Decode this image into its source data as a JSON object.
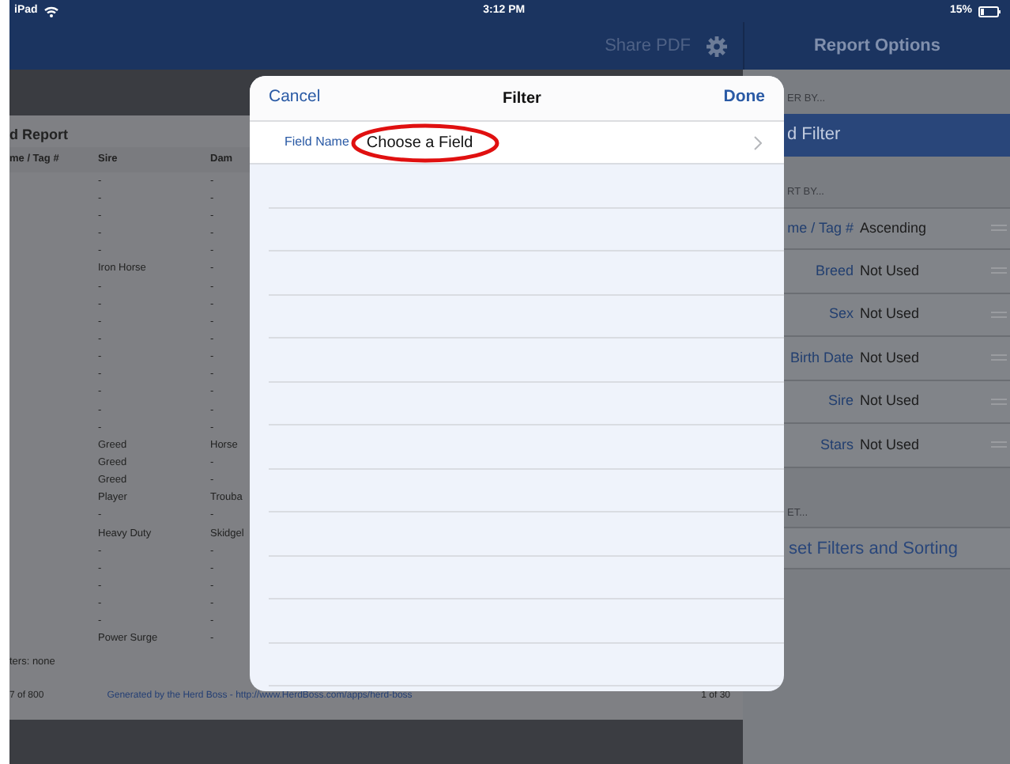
{
  "status_bar": {
    "device": "iPad",
    "time": "3:12 PM",
    "battery": "15%"
  },
  "toolbar": {
    "share": "Share PDF"
  },
  "report": {
    "title": "d Report",
    "columns": [
      "me / Tag #",
      "Sire",
      "Dam"
    ],
    "rows": [
      [
        "",
        "-",
        "-"
      ],
      [
        "",
        "-",
        "-"
      ],
      [
        "",
        "-",
        "-"
      ],
      [
        "",
        "-",
        "-"
      ],
      [
        "",
        "-",
        "-"
      ],
      [
        "",
        "Iron Horse",
        "-"
      ],
      [
        "",
        "-",
        "-"
      ],
      [
        "",
        "-",
        "-"
      ],
      [
        "",
        "-",
        "-"
      ],
      [
        "",
        "-",
        "-"
      ],
      [
        "",
        "-",
        "-"
      ],
      [
        "",
        "-",
        "-"
      ],
      [
        "",
        "-",
        "-"
      ],
      [
        "",
        "-",
        "-"
      ],
      [
        "",
        "-",
        "-"
      ],
      [
        "",
        "Greed",
        "Horse"
      ],
      [
        "",
        "Greed",
        "-"
      ],
      [
        "",
        "Greed",
        "-"
      ],
      [
        "",
        "Player",
        "Trouba"
      ],
      [
        "",
        "-",
        "-"
      ],
      [
        "",
        "Heavy Duty",
        "Skidgel"
      ],
      [
        "",
        "-",
        "-"
      ],
      [
        "",
        "-",
        "-"
      ],
      [
        "",
        "-",
        "-"
      ],
      [
        "",
        "-",
        "-"
      ],
      [
        "",
        "-",
        "-"
      ],
      [
        "",
        "Power Surge",
        "-"
      ]
    ],
    "filters": "ters:  none",
    "count": "7 of 800",
    "generated": "Generated by the Herd Boss - http://www.HerdBoss.com/apps/herd-boss",
    "page": "1 of 30"
  },
  "report_options": {
    "title": "Report Options",
    "filter_header": "ER BY...",
    "add_filter": "d Filter",
    "sort_header": "RT BY...",
    "sort_rows": [
      {
        "field": "me / Tag #",
        "order": "Ascending"
      },
      {
        "field": "Breed",
        "order": "Not Used"
      },
      {
        "field": "Sex",
        "order": "Not Used"
      },
      {
        "field": "Birth Date",
        "order": "Not Used"
      },
      {
        "field": "Sire",
        "order": "Not Used"
      },
      {
        "field": "Stars",
        "order": "Not Used"
      }
    ],
    "reset_header": "ET...",
    "reset": "set Filters and Sorting"
  },
  "filter_dialog": {
    "cancel": "Cancel",
    "title": "Filter",
    "done": "Done",
    "field": {
      "label": "Field Name",
      "value": "Choose a Field",
      "highlighted": true
    }
  }
}
